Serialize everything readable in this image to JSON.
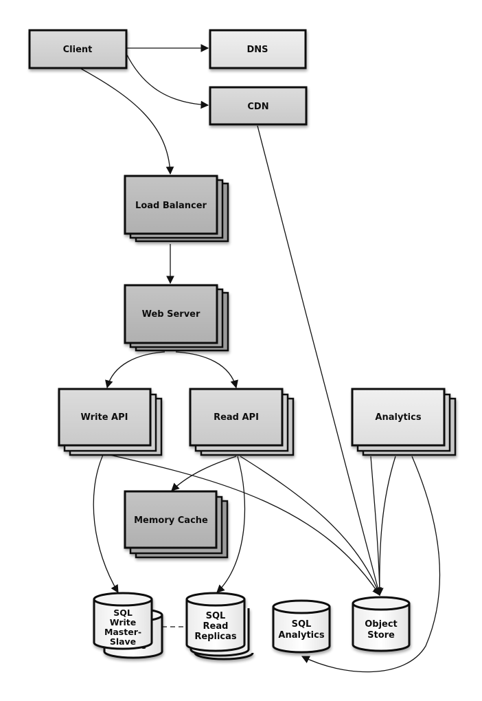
{
  "diagram": {
    "nodes": {
      "client": {
        "label": "Client"
      },
      "dns": {
        "label": "DNS"
      },
      "cdn": {
        "label": "CDN"
      },
      "load_balancer": {
        "label": "Load Balancer"
      },
      "web_server": {
        "label": "Web Server"
      },
      "write_api": {
        "label": "Write API"
      },
      "read_api": {
        "label": "Read API"
      },
      "analytics": {
        "label": "Analytics"
      },
      "memory_cache": {
        "label": "Memory Cache"
      },
      "sql_write": {
        "lines": [
          "SQL",
          "Write",
          "Master-",
          "Slave"
        ],
        "shadow_label": "Slave"
      },
      "sql_read": {
        "lines": [
          "SQL",
          "Read",
          "Replicas"
        ]
      },
      "sql_analytics": {
        "lines": [
          "SQL",
          "Analytics"
        ]
      },
      "object_store": {
        "lines": [
          "Object",
          "Store"
        ]
      }
    },
    "edges": [
      {
        "from": "Client",
        "to": "DNS"
      },
      {
        "from": "Client",
        "to": "CDN"
      },
      {
        "from": "Client",
        "to": "Load Balancer"
      },
      {
        "from": "CDN",
        "to": "Object Store"
      },
      {
        "from": "Load Balancer",
        "to": "Web Server"
      },
      {
        "from": "Web Server",
        "to": "Write API"
      },
      {
        "from": "Web Server",
        "to": "Read API"
      },
      {
        "from": "Write API",
        "to": "SQL Write Master-Slave"
      },
      {
        "from": "Write API",
        "to": "Object Store"
      },
      {
        "from": "Read API",
        "to": "Memory Cache"
      },
      {
        "from": "Read API",
        "to": "SQL Read Replicas"
      },
      {
        "from": "Read API",
        "to": "Object Store"
      },
      {
        "from": "Analytics",
        "to": "Object Store"
      },
      {
        "from": "Analytics",
        "to": "SQL Analytics"
      },
      {
        "from": "SQL Write Master-Slave",
        "to": "SQL Read Replicas",
        "style": "dashed"
      }
    ],
    "colors": {
      "light_fill": "#e4e4e4",
      "mid_fill": "#d2d2d2",
      "dark_fill": "#b8b8b8",
      "stroke": "#111111"
    }
  }
}
